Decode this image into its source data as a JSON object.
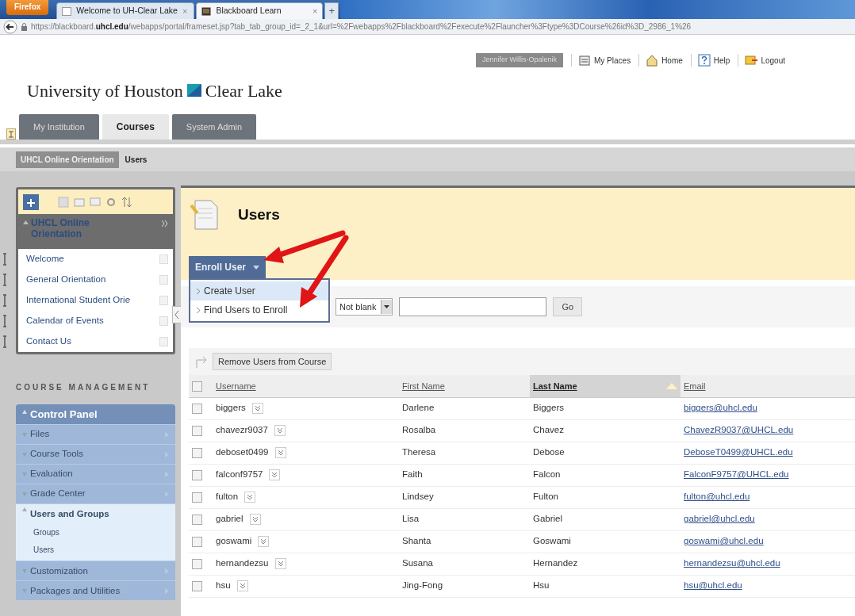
{
  "browser": {
    "menu_button": "Firefox",
    "tabs": [
      {
        "title": "Welcome to UH-Clear Lake",
        "close": "×",
        "selected": false
      },
      {
        "title": "Blackboard Learn",
        "close": "×",
        "selected": true
      }
    ],
    "new_tab": "+",
    "address": "https://blackboard.**uhcl.edu**/webapps/portal/frameset.jsp?tab_tab_group_id=_2_1&url=%2Fwebapps%2Fblackboard%2Fexecute%2Flauncher%3Ftype%3DCourse%26id%3D_2986_1%26"
  },
  "header": {
    "logo_left": "University of Houston",
    "logo_right": "Clear Lake",
    "user": "Jennifer Willis-Opalenik",
    "links": [
      "My Places",
      "Home",
      "Help",
      "Logout"
    ]
  },
  "nav_tabs": [
    {
      "label": "My Institution",
      "selected": false
    },
    {
      "label": "Courses",
      "selected": true
    },
    {
      "label": "System Admin",
      "selected": false
    }
  ],
  "breadcrumbs": [
    "UHCL Online Orientation",
    "Users"
  ],
  "course_menu": {
    "title": "UHCL Online Orientation",
    "expanded": true,
    "items": [
      "Welcome",
      "General Orientation",
      "International Student Orie",
      "Calendar of Events",
      "Contact Us"
    ]
  },
  "course_management": {
    "title": "COURSE MANAGEMENT",
    "panel": "Control Panel",
    "expanded": true,
    "sections": [
      {
        "label": "Files",
        "expanded": false
      },
      {
        "label": "Course Tools",
        "expanded": false
      },
      {
        "label": "Evaluation",
        "expanded": false
      },
      {
        "label": "Grade Center",
        "expanded": false
      },
      {
        "label": "Users and Groups",
        "expanded": true,
        "children": [
          "Groups",
          "Users"
        ]
      },
      {
        "label": "Customization",
        "expanded": false
      },
      {
        "label": "Packages and Utilities",
        "expanded": false
      }
    ]
  },
  "page": {
    "title": "Users",
    "enroll_button": "Enroll User",
    "enroll_menu": [
      {
        "label": "Create User",
        "selected": true
      },
      {
        "label": "Find Users to Enroll",
        "selected": false
      }
    ],
    "filter": {
      "operator": "Not blank",
      "button": "Go"
    },
    "remove_button": "Remove Users from Course"
  },
  "table": {
    "select_all_checked": false,
    "columns": [
      {
        "label": "Username",
        "sorted": false
      },
      {
        "label": "First Name",
        "sorted": false
      },
      {
        "label": "Last Name",
        "sorted": true
      },
      {
        "label": "Email",
        "sorted": false
      }
    ],
    "rows": [
      {
        "username": "biggers",
        "first_name": "Darlene",
        "last_name": "Biggers",
        "email": "biggers@uhcl.edu",
        "checked": false
      },
      {
        "username": "chavezr9037",
        "first_name": "Rosalba",
        "last_name": "Chavez",
        "email": "ChavezR9037@UHCL.edu",
        "checked": false
      },
      {
        "username": "deboset0499",
        "first_name": "Theresa",
        "last_name": "Debose",
        "email": "DeboseT0499@UHCL.edu",
        "checked": false
      },
      {
        "username": "falconf9757",
        "first_name": "Faith",
        "last_name": "Falcon",
        "email": "FalconF9757@UHCL.edu",
        "checked": false
      },
      {
        "username": "fulton",
        "first_name": "Lindsey",
        "last_name": "Fulton",
        "email": "fulton@uhcl.edu",
        "checked": false
      },
      {
        "username": "gabriel",
        "first_name": "Lisa",
        "last_name": "Gabriel",
        "email": "gabriel@uhcl.edu",
        "checked": false
      },
      {
        "username": "goswami",
        "first_name": "Shanta",
        "last_name": "Goswami",
        "email": "goswami@uhcl.edu",
        "checked": false
      },
      {
        "username": "hernandezsu",
        "first_name": "Susana",
        "last_name": "Hernandez",
        "email": "hernandezsu@uhcl.edu",
        "checked": false
      },
      {
        "username": "hsu",
        "first_name": "Jing-Fong",
        "last_name": "Hsu",
        "email": "hsu@uhcl.edu",
        "checked": false
      }
    ]
  }
}
